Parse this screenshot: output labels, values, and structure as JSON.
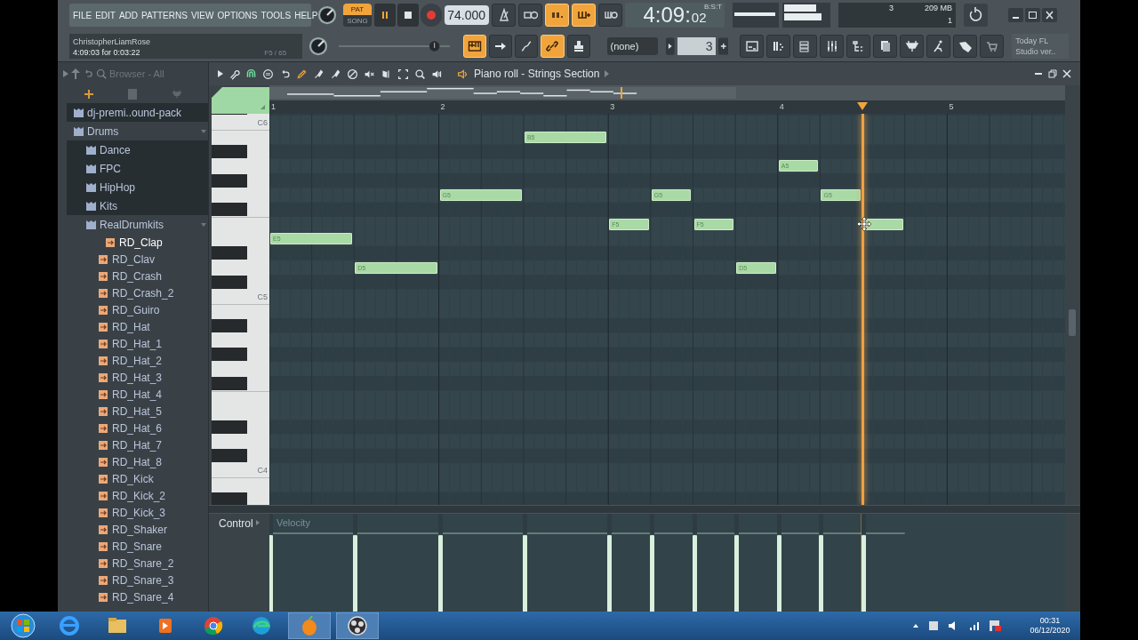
{
  "menu": [
    "FILE",
    "EDIT",
    "ADD",
    "PATTERNS",
    "VIEW",
    "OPTIONS",
    "TOOLS",
    "HELP"
  ],
  "pat_song": [
    {
      "label": "PAT",
      "selected": true
    },
    {
      "label": "SONG",
      "selected": false
    }
  ],
  "tempo": "74.000",
  "time": {
    "main": "4:09:",
    "sub": "02",
    "unit": "B:S:T"
  },
  "cpu": {
    "voices": "3",
    "memory": "209 MB",
    "polyphony": "1"
  },
  "hint": {
    "user": "ChristopherLiamRose",
    "position": "4:09:03 for 0:03:22",
    "note": "F5 / 65"
  },
  "record_tools": [
    {
      "kind": "metronome",
      "on": false
    },
    {
      "kind": "countdown",
      "on": false
    },
    {
      "kind": "step",
      "on": true
    },
    {
      "kind": "overdub",
      "on": true
    },
    {
      "kind": "loop",
      "on": false
    }
  ],
  "edit_tools": [
    {
      "kind": "keyboard",
      "on": true
    },
    {
      "kind": "arrow",
      "on": false
    },
    {
      "kind": "scribble",
      "on": false
    },
    {
      "kind": "link",
      "on": true
    },
    {
      "kind": "stamp",
      "on": false
    }
  ],
  "master_pitch": {
    "level": 0.86
  },
  "pattern": "(none)",
  "pattern_number": "3",
  "window_tools": [
    {
      "kind": "playlist"
    },
    {
      "kind": "rack"
    },
    {
      "kind": "list"
    },
    {
      "kind": "mixer"
    },
    {
      "kind": "tree"
    },
    {
      "kind": "pages"
    },
    {
      "kind": "plug"
    },
    {
      "kind": "figure"
    },
    {
      "kind": "hand"
    },
    {
      "kind": "cart"
    }
  ],
  "news": "Today FL Studio ver..",
  "browser": {
    "title": "Browser - All",
    "tree": [
      {
        "label": "dj-premi..ound-pack",
        "kind": "folder",
        "expanded": false,
        "selected": false
      },
      {
        "label": "Drums",
        "kind": "folder",
        "expanded": true,
        "selected": false,
        "children": [
          {
            "label": "Dance",
            "kind": "folder",
            "expanded": false,
            "selected": false
          },
          {
            "label": "FPC",
            "kind": "folder",
            "expanded": false,
            "selected": false
          },
          {
            "label": "HipHop",
            "kind": "folder",
            "expanded": false,
            "selected": false
          },
          {
            "label": "Kits",
            "kind": "folder",
            "expanded": false,
            "selected": false
          },
          {
            "label": "RealDrumkits",
            "kind": "folder",
            "expanded": true,
            "selected": false,
            "children": [
              {
                "label": "RD_Clap",
                "kind": "sample",
                "selected": true
              },
              {
                "label": "RD_Clav",
                "kind": "sample",
                "selected": false
              },
              {
                "label": "RD_Crash",
                "kind": "sample",
                "selected": false
              },
              {
                "label": "RD_Crash_2",
                "kind": "sample",
                "selected": false
              },
              {
                "label": "RD_Guiro",
                "kind": "sample",
                "selected": false
              },
              {
                "label": "RD_Hat",
                "kind": "sample",
                "selected": false
              },
              {
                "label": "RD_Hat_1",
                "kind": "sample",
                "selected": false
              },
              {
                "label": "RD_Hat_2",
                "kind": "sample",
                "selected": false
              },
              {
                "label": "RD_Hat_3",
                "kind": "sample",
                "selected": false
              },
              {
                "label": "RD_Hat_4",
                "kind": "sample",
                "selected": false
              },
              {
                "label": "RD_Hat_5",
                "kind": "sample",
                "selected": false
              },
              {
                "label": "RD_Hat_6",
                "kind": "sample",
                "selected": false
              },
              {
                "label": "RD_Hat_7",
                "kind": "sample",
                "selected": false
              },
              {
                "label": "RD_Hat_8",
                "kind": "sample",
                "selected": false
              },
              {
                "label": "RD_Kick",
                "kind": "sample",
                "selected": false
              },
              {
                "label": "RD_Kick_2",
                "kind": "sample",
                "selected": false
              },
              {
                "label": "RD_Kick_3",
                "kind": "sample",
                "selected": false
              },
              {
                "label": "RD_Shaker",
                "kind": "sample",
                "selected": false
              },
              {
                "label": "RD_Snare",
                "kind": "sample",
                "selected": false
              },
              {
                "label": "RD_Snare_2",
                "kind": "sample",
                "selected": false
              },
              {
                "label": "RD_Snare_3",
                "kind": "sample",
                "selected": false
              },
              {
                "label": "RD_Snare_4",
                "kind": "sample",
                "selected": false
              }
            ]
          }
        ]
      }
    ]
  },
  "piano_roll": {
    "title": "Piano roll - Strings Section",
    "tools": [
      {
        "kind": "wrench",
        "on": false
      },
      {
        "kind": "magnet",
        "on": true
      },
      {
        "kind": "circle",
        "on": false
      },
      {
        "kind": "undo",
        "on": false
      },
      {
        "kind": "pencil",
        "on": true
      },
      {
        "kind": "brush",
        "on": false
      },
      {
        "kind": "brush",
        "on": false
      },
      {
        "kind": "delete",
        "on": false
      },
      {
        "kind": "mute",
        "on": false
      },
      {
        "kind": "slice",
        "on": false
      },
      {
        "kind": "select",
        "on": false
      },
      {
        "kind": "zoom",
        "on": false
      },
      {
        "kind": "speaker",
        "on": false
      }
    ],
    "ruler": [
      "1",
      "2",
      "3",
      "4",
      "5"
    ],
    "keys": [
      "C6",
      "C5",
      "C4"
    ],
    "notes": [
      {
        "label": "E5",
        "level": 0.8
      },
      {
        "label": "D5",
        "level": 0.8
      },
      {
        "label": "G5",
        "level": 0.8
      },
      {
        "label": "B5",
        "level": 0.8
      },
      {
        "label": "F5",
        "level": 0.8
      },
      {
        "label": "G5",
        "level": 0.8
      },
      {
        "label": "F5",
        "level": 0.8
      },
      {
        "label": "D5",
        "level": 0.8
      },
      {
        "label": "A5",
        "level": 0.8
      },
      {
        "label": "G5",
        "level": 0.8
      },
      {
        "level": 0.8
      }
    ],
    "control": {
      "label": "Control",
      "target": "Velocity"
    }
  },
  "taskbar": {
    "apps": [
      {
        "kind": "ie"
      },
      {
        "kind": "folder"
      },
      {
        "kind": "media"
      },
      {
        "kind": "chrome"
      },
      {
        "kind": "edge"
      },
      {
        "kind": "fl"
      },
      {
        "kind": "obs"
      }
    ],
    "clock": "00:31",
    "date": "06/12/2020"
  }
}
